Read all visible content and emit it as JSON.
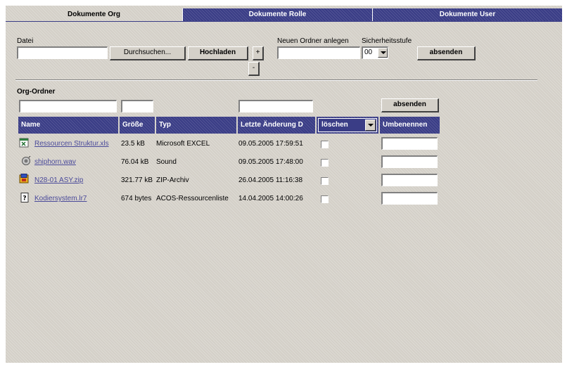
{
  "tabs": [
    "Dokumente Org",
    "Dokumente Rolle",
    "Dokumente User"
  ],
  "upload": {
    "datei_label": "Datei",
    "browse_label": "Durchsuchen...",
    "upload_label": "Hochladen",
    "plus_label": "+",
    "minus_label": "-",
    "new_folder_label": "Neuen Ordner anlegen",
    "security_label": "Sicherheitsstufe",
    "security_value": "00",
    "submit_label": "absenden"
  },
  "org": {
    "section_label": "Org-Ordner",
    "filter_submit_label": "absenden",
    "columns": [
      "Name",
      "Größe",
      "Typ",
      "Letzte Änderung D",
      "löschen",
      "Umbenennen"
    ],
    "rows": [
      {
        "name": "Ressourcen Struktur.xls",
        "size": "23.5 kB",
        "type": "Microsoft EXCEL",
        "modified": "09.05.2005 17:59:51",
        "icon": "excel-file-icon"
      },
      {
        "name": "shiphorn.wav",
        "size": "76.04 kB",
        "type": "Sound",
        "modified": "09.05.2005 17:48:00",
        "icon": "sound-file-icon"
      },
      {
        "name": "N28-01 ASY.zip",
        "size": "321.77 kB",
        "type": "ZIP-Archiv",
        "modified": "26.04.2005 11:16:38",
        "icon": "zip-file-icon"
      },
      {
        "name": "Kodiersystem.lr7",
        "size": "674 bytes",
        "type": "ACOS-Ressourcenliste",
        "modified": "14.04.2005 14:00:26",
        "icon": "unknown-file-icon"
      }
    ]
  }
}
